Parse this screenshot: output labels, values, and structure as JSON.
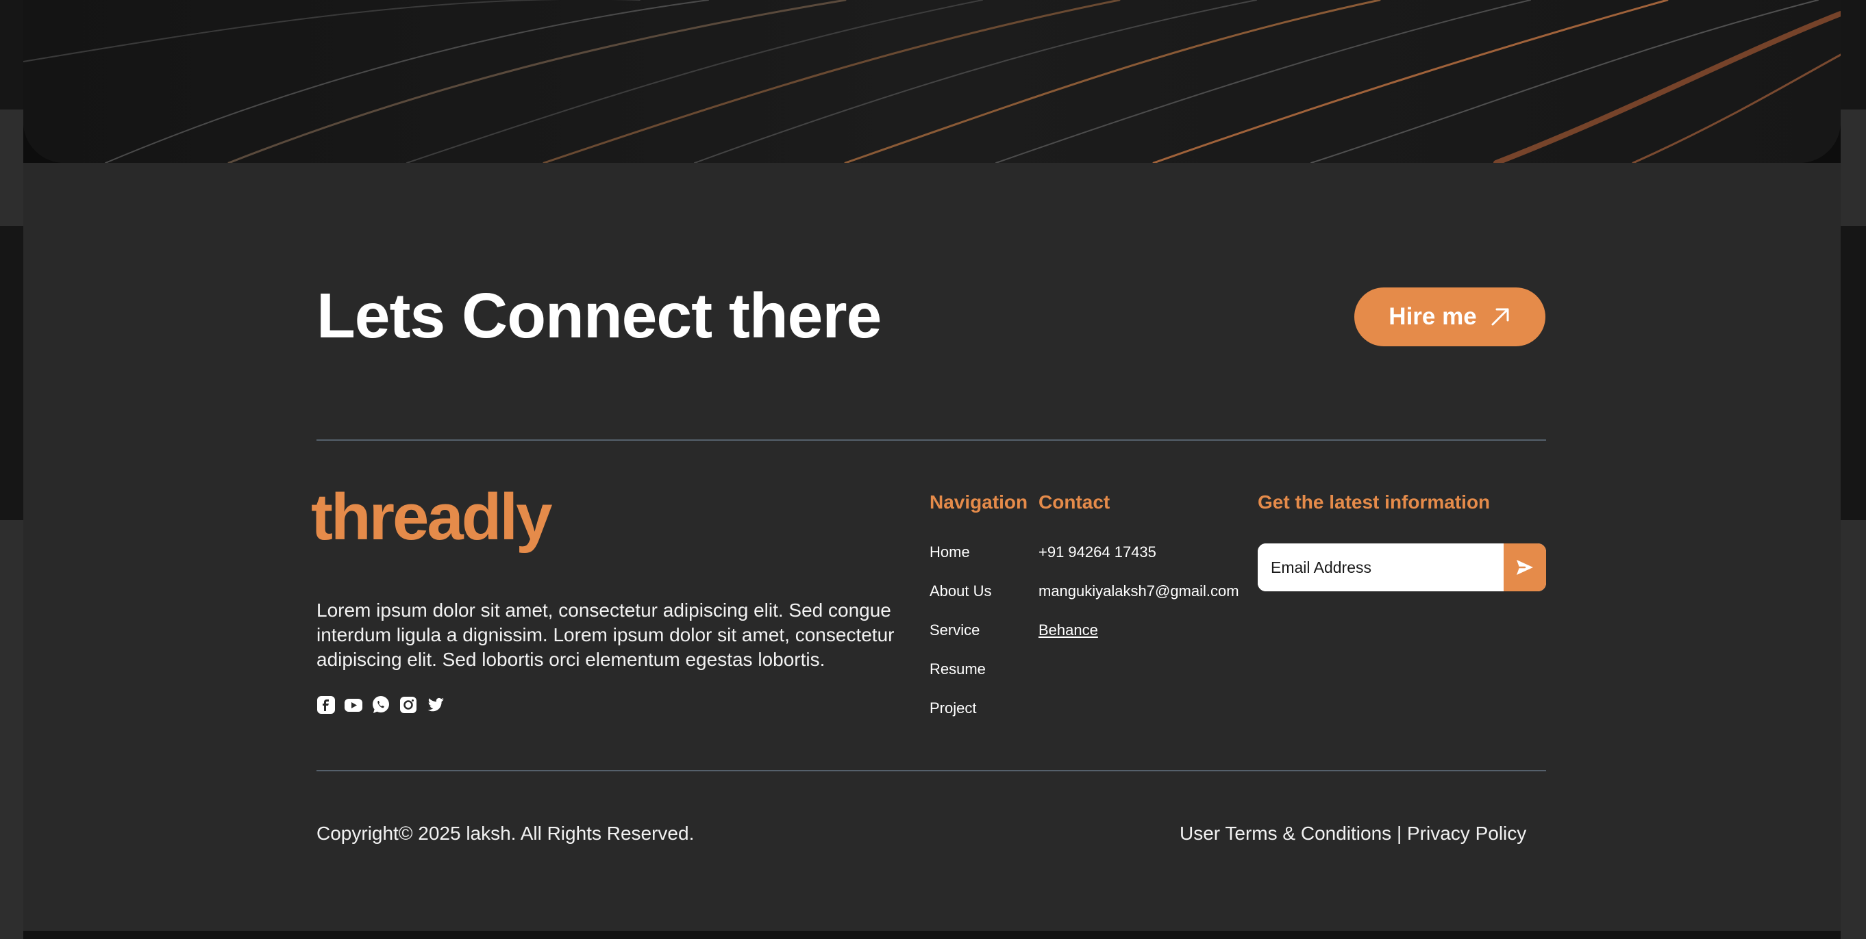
{
  "footer": {
    "headline": "Lets Connect there",
    "hire_button": {
      "label": "Hire me",
      "icon": "arrow-up-right-icon"
    },
    "logo_text": "threadly",
    "about_text": "Lorem ipsum dolor sit amet, consectetur adipiscing elit. Sed congue interdum ligula a dignissim. Lorem ipsum dolor sit amet, consectetur adipiscing elit. Sed lobortis orci elementum egestas lobortis.",
    "socials": [
      "facebook-icon",
      "youtube-icon",
      "whatsapp-icon",
      "instagram-icon",
      "twitter-icon"
    ],
    "navigation": {
      "heading": "Navigation",
      "items": [
        "Home",
        "About Us",
        "Service",
        "Resume",
        "Project"
      ]
    },
    "contact": {
      "heading": "Contact",
      "phone": "+91 94264 17435",
      "email": "mangukiyalaksh7@gmail.com",
      "behance": "Behance"
    },
    "newsletter": {
      "heading": "Get the latest information",
      "placeholder": "Email Address",
      "send_icon": "send-icon"
    },
    "copyright": "Copyright© 2025 laksh. All Rights Reserved.",
    "legal": {
      "terms": "User Terms & Conditions",
      "separator": "|",
      "privacy": "Privacy Policy"
    }
  },
  "colors": {
    "accent": "#e58b4a",
    "panel": "#292929",
    "divider": "#55606b",
    "text": "#ffffff"
  }
}
